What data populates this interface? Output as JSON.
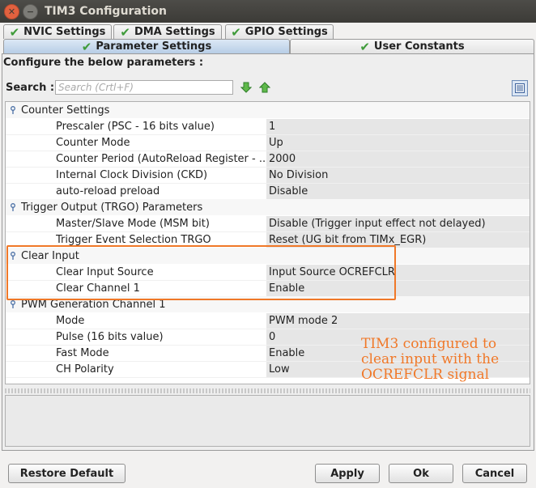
{
  "window": {
    "title": "TIM3 Configuration"
  },
  "tabs": [
    {
      "label": "NVIC Settings"
    },
    {
      "label": "DMA Settings"
    },
    {
      "label": "GPIO Settings"
    },
    {
      "label": "Parameter Settings"
    },
    {
      "label": "User Constants"
    }
  ],
  "panel": {
    "heading": "Configure the below parameters :"
  },
  "search": {
    "label": "Search :",
    "placeholder": "Search (Crtl+F)"
  },
  "groups": [
    {
      "name": "Counter Settings",
      "params": [
        {
          "name": "Prescaler (PSC - 16 bits value)",
          "value": "1"
        },
        {
          "name": "Counter Mode",
          "value": "Up"
        },
        {
          "name": "Counter Period (AutoReload Register - ...",
          "value": "2000"
        },
        {
          "name": "Internal Clock Division (CKD)",
          "value": "No Division"
        },
        {
          "name": "auto-reload preload",
          "value": "Disable"
        }
      ]
    },
    {
      "name": "Trigger Output (TRGO) Parameters",
      "params": [
        {
          "name": "Master/Slave Mode (MSM bit)",
          "value": "Disable (Trigger input effect not delayed)"
        },
        {
          "name": "Trigger Event Selection TRGO",
          "value": "Reset (UG bit from TIMx_EGR)"
        }
      ]
    },
    {
      "name": "Clear Input",
      "params": [
        {
          "name": "Clear Input Source",
          "value": "Input Source OCREFCLR"
        },
        {
          "name": "Clear Channel 1",
          "value": "Enable"
        }
      ]
    },
    {
      "name": "PWM Generation Channel 1",
      "params": [
        {
          "name": "Mode",
          "value": "PWM mode 2"
        },
        {
          "name": "Pulse (16 bits value)",
          "value": "0"
        },
        {
          "name": "Fast Mode",
          "value": "Enable"
        },
        {
          "name": "CH Polarity",
          "value": "Low"
        }
      ]
    }
  ],
  "annotation": {
    "lines": [
      "TIM3 configured to",
      "clear input with the",
      "OCREFCLR signal"
    ]
  },
  "buttons": {
    "restore_default": "Restore Default",
    "apply": "Apply",
    "ok": "Ok",
    "cancel": "Cancel"
  },
  "colors": {
    "highlight": "#f07828",
    "check": "#3f9b3a",
    "active_tab": "#b7cde6"
  }
}
